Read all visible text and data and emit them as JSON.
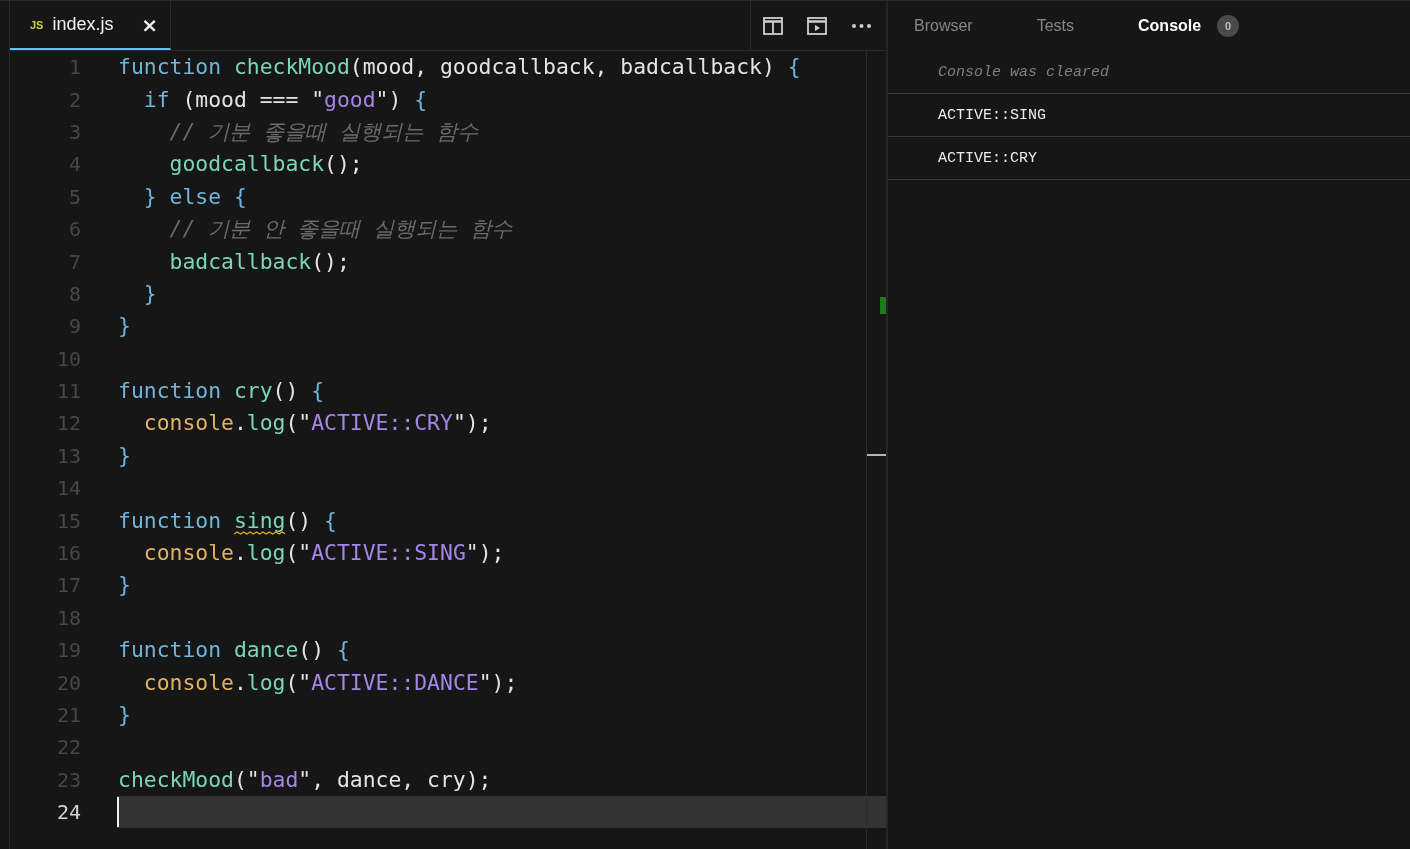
{
  "editor": {
    "tabs": [
      {
        "type_label": "JS",
        "label": "index.js",
        "close": "×",
        "selected": true
      }
    ],
    "lines": [
      {
        "number": "1",
        "current": false,
        "tokens": [
          {
            "text": "function",
            "kind": "keyword",
            "warning": false
          },
          {
            "text": " checkMood",
            "kind": "function",
            "warning": false
          },
          {
            "text": "(mood, goodcallback, badcallback) ",
            "kind": "plain",
            "warning": false
          },
          {
            "text": "{",
            "kind": "brace",
            "warning": false
          }
        ]
      },
      {
        "number": "2",
        "current": false,
        "tokens": [
          {
            "text": "  if",
            "kind": "keyword",
            "warning": false
          },
          {
            "text": " (mood === \"",
            "kind": "plain",
            "warning": false
          },
          {
            "text": "good",
            "kind": "string",
            "warning": false
          },
          {
            "text": "\") ",
            "kind": "plain",
            "warning": false
          },
          {
            "text": "{",
            "kind": "brace",
            "warning": false
          }
        ]
      },
      {
        "number": "3",
        "current": false,
        "tokens": [
          {
            "text": "    // 기분 좋을때 실행되는 함수",
            "kind": "comment",
            "warning": false
          }
        ]
      },
      {
        "number": "4",
        "current": false,
        "tokens": [
          {
            "text": "    goodcallback",
            "kind": "function",
            "warning": false
          },
          {
            "text": "();",
            "kind": "plain",
            "warning": false
          }
        ]
      },
      {
        "number": "5",
        "current": false,
        "tokens": [
          {
            "text": "  }",
            "kind": "brace",
            "warning": false
          },
          {
            "text": " else",
            "kind": "keyword",
            "warning": false
          },
          {
            "text": " {",
            "kind": "brace",
            "warning": false
          }
        ]
      },
      {
        "number": "6",
        "current": false,
        "tokens": [
          {
            "text": "    // 기분 안 좋을때 실행되는 함수",
            "kind": "comment",
            "warning": false
          }
        ]
      },
      {
        "number": "7",
        "current": false,
        "tokens": [
          {
            "text": "    badcallback",
            "kind": "function",
            "warning": false
          },
          {
            "text": "();",
            "kind": "plain",
            "warning": false
          }
        ]
      },
      {
        "number": "8",
        "current": false,
        "tokens": [
          {
            "text": "  }",
            "kind": "brace",
            "warning": false
          }
        ]
      },
      {
        "number": "9",
        "current": false,
        "tokens": [
          {
            "text": "}",
            "kind": "brace",
            "warning": false
          }
        ]
      },
      {
        "number": "10",
        "current": false
      },
      {
        "number": "11",
        "current": false,
        "tokens": [
          {
            "text": "function",
            "kind": "keyword",
            "warning": false
          },
          {
            "text": " cry",
            "kind": "function",
            "warning": false
          },
          {
            "text": "() ",
            "kind": "plain",
            "warning": false
          },
          {
            "text": "{",
            "kind": "brace",
            "warning": false
          }
        ]
      },
      {
        "number": "12",
        "current": false,
        "tokens": [
          {
            "text": "  console",
            "kind": "object",
            "warning": false
          },
          {
            "text": ".",
            "kind": "plain",
            "warning": false
          },
          {
            "text": "log",
            "kind": "function",
            "warning": false
          },
          {
            "text": "(\"",
            "kind": "plain",
            "warning": false
          },
          {
            "text": "ACTIVE::CRY",
            "kind": "string",
            "warning": false
          },
          {
            "text": "\");",
            "kind": "plain",
            "warning": false
          }
        ]
      },
      {
        "number": "13",
        "current": false,
        "tokens": [
          {
            "text": "}",
            "kind": "brace",
            "warning": false
          }
        ]
      },
      {
        "number": "14",
        "current": false
      },
      {
        "number": "15",
        "current": false,
        "tokens": [
          {
            "text": "function ",
            "kind": "keyword",
            "warning": false
          },
          {
            "text": "sing",
            "kind": "function",
            "warning": true
          },
          {
            "text": "() ",
            "kind": "plain",
            "warning": false
          },
          {
            "text": "{",
            "kind": "brace",
            "warning": false
          }
        ]
      },
      {
        "number": "16",
        "current": false,
        "tokens": [
          {
            "text": "  console",
            "kind": "object",
            "warning": false
          },
          {
            "text": ".",
            "kind": "plain",
            "warning": false
          },
          {
            "text": "log",
            "kind": "function",
            "warning": false
          },
          {
            "text": "(\"",
            "kind": "plain",
            "warning": false
          },
          {
            "text": "ACTIVE::SING",
            "kind": "string",
            "warning": false
          },
          {
            "text": "\");",
            "kind": "plain",
            "warning": false
          }
        ]
      },
      {
        "number": "17",
        "current": false,
        "tokens": [
          {
            "text": "}",
            "kind": "brace",
            "warning": false
          }
        ]
      },
      {
        "number": "18",
        "current": false
      },
      {
        "number": "19",
        "current": false,
        "tokens": [
          {
            "text": "function",
            "kind": "keyword",
            "warning": false
          },
          {
            "text": " dance",
            "kind": "function",
            "warning": false
          },
          {
            "text": "() ",
            "kind": "plain",
            "warning": false
          },
          {
            "text": "{",
            "kind": "brace",
            "warning": false
          }
        ]
      },
      {
        "number": "20",
        "current": false,
        "tokens": [
          {
            "text": "  console",
            "kind": "object",
            "warning": false
          },
          {
            "text": ".",
            "kind": "plain",
            "warning": false
          },
          {
            "text": "log",
            "kind": "function",
            "warning": false
          },
          {
            "text": "(\"",
            "kind": "plain",
            "warning": false
          },
          {
            "text": "ACTIVE::DANCE",
            "kind": "string",
            "warning": false
          },
          {
            "text": "\");",
            "kind": "plain",
            "warning": false
          }
        ]
      },
      {
        "number": "21",
        "current": false,
        "tokens": [
          {
            "text": "}",
            "kind": "brace",
            "warning": false
          }
        ]
      },
      {
        "number": "22",
        "current": false
      },
      {
        "number": "23",
        "current": false,
        "tokens": [
          {
            "text": "checkMood",
            "kind": "function",
            "warning": false
          },
          {
            "text": "(\"",
            "kind": "plain",
            "warning": false
          },
          {
            "text": "bad",
            "kind": "string",
            "warning": false
          },
          {
            "text": "\", dance, cry);",
            "kind": "plain",
            "warning": false
          }
        ]
      },
      {
        "number": "24",
        "current": true
      }
    ]
  },
  "panel": {
    "tabs": [
      {
        "label": "Browser",
        "selected": false
      },
      {
        "label": "Tests",
        "selected": false
      },
      {
        "label": "Console",
        "selected": true,
        "badge": "0"
      }
    ],
    "messages": [
      {
        "text": "Console was cleared",
        "kind": "info"
      },
      {
        "text": "ACTIVE::SING",
        "kind": "log"
      },
      {
        "text": "ACTIVE::CRY",
        "kind": "log"
      }
    ]
  }
}
